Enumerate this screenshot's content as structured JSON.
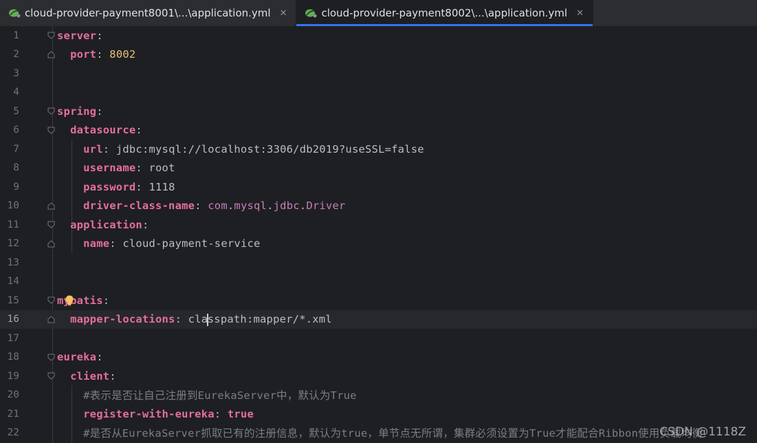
{
  "tabs": [
    {
      "label": "cloud-provider-payment8001\\...\\application.yml",
      "active": false
    },
    {
      "label": "cloud-provider-payment8002\\...\\application.yml",
      "active": true
    }
  ],
  "close_glyph": "✕",
  "current_line": 16,
  "lines": [
    {
      "n": "1",
      "html": "<span class=\"key\">server</span>:"
    },
    {
      "n": "2",
      "html": "  <span class=\"key\">port</span>: <span class=\"num\">8002</span>"
    },
    {
      "n": "3",
      "html": ""
    },
    {
      "n": "4",
      "html": ""
    },
    {
      "n": "5",
      "html": "<span class=\"key\">spring</span>:"
    },
    {
      "n": "6",
      "html": "  <span class=\"key\">datasource</span>:"
    },
    {
      "n": "7",
      "html": "    <span class=\"key\">url</span>: jdbc:mysql://localhost:3306/db2019?useSSL=false"
    },
    {
      "n": "8",
      "html": "    <span class=\"key\">username</span>: root"
    },
    {
      "n": "9",
      "html": "    <span class=\"key\">password</span>: 1118"
    },
    {
      "n": "10",
      "html": "    <span class=\"key\">driver-class-name</span>: <span class=\"cls\">com</span>.<span class=\"cls\">mysql</span>.<span class=\"cls\">jdbc</span>.<span class=\"cls\">Driver</span>"
    },
    {
      "n": "11",
      "html": "  <span class=\"key\">application</span>:"
    },
    {
      "n": "12",
      "html": "    <span class=\"key\">name</span>: cloud-payment-service"
    },
    {
      "n": "13",
      "html": ""
    },
    {
      "n": "14",
      "html": ""
    },
    {
      "n": "15",
      "html": "<span class=\"key\">mybatis</span>:"
    },
    {
      "n": "16",
      "html": "  <span class=\"key\">mapper-locations</span>: cla<span class=\"caret\"></span>sspath:mapper/*.xml"
    },
    {
      "n": "17",
      "html": ""
    },
    {
      "n": "18",
      "html": "<span class=\"key\">eureka</span>:"
    },
    {
      "n": "19",
      "html": "  <span class=\"key\">client</span>:"
    },
    {
      "n": "20",
      "html": "    <span class=\"cmt\">#表示是否让自己注册到EurekaServer中，默认为True</span>"
    },
    {
      "n": "21",
      "html": "    <span class=\"key\">register-with-eureka</span>: <span class=\"kw\">true</span>"
    },
    {
      "n": "22",
      "html": "    <span class=\"cmt\">#是否从EurekaServer抓取已有的注册信息，默认为true，单节点无所谓，集群必须设置为True才能配合Ribbon使用负载均衡</span>"
    }
  ],
  "watermark": "CSDN @1118Z"
}
